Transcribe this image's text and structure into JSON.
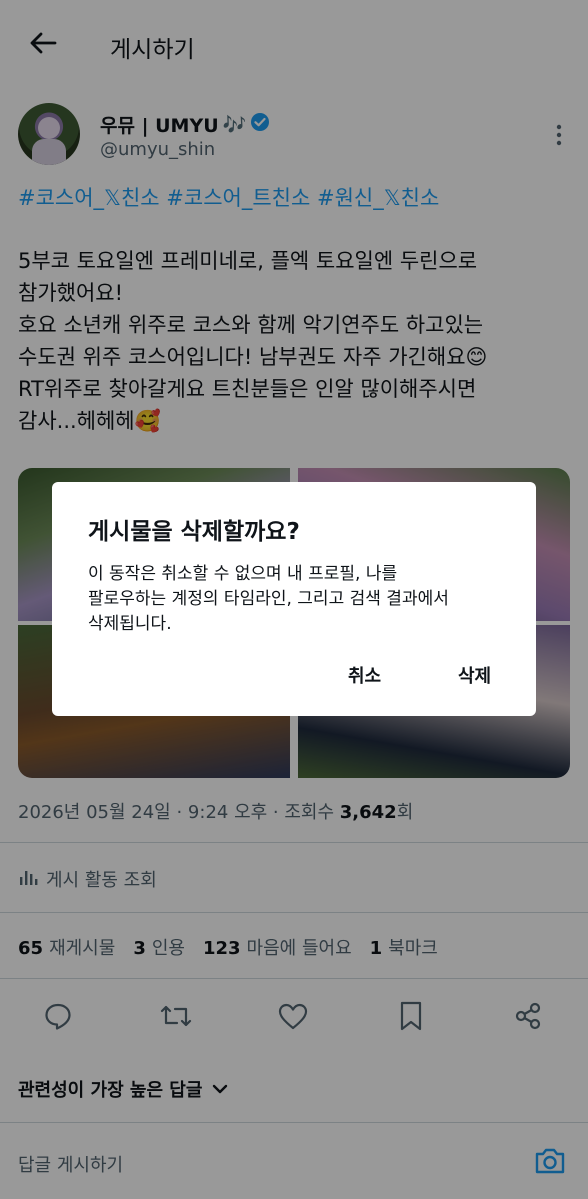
{
  "header": {
    "title": "게시하기",
    "back_icon": "arrow-left-icon"
  },
  "author": {
    "name": "우뮤 | UMYU",
    "name_emoji": "🎶",
    "handle": "@umyu_shin",
    "verified": true,
    "verified_color": "#1d9bf0"
  },
  "post": {
    "hashtags": "#코스어_𝕏친소 #코스어_트친소 #원신_𝕏친소",
    "lines": [
      "5부코 토요일엔 프레미네로, 플엑 토요일엔 두린으로",
      "참가했어요!",
      "호요 소년캐 위주로 코스와 함께 악기연주도 하고있는",
      "수도권 위주 코스어입니다! 남부권도 자주 가긴해요😊",
      "RT위주로 찾아갈게요 트친분들은 인알 많이해주시면",
      "감사...헤헤헤🥰"
    ]
  },
  "timestamp": {
    "date": "2026년 05월 24일",
    "sep1": " · ",
    "time": "9:24 오후",
    "sep2": " · ",
    "views_label": "조회수 ",
    "views": "3,642",
    "views_suffix": "회"
  },
  "activity": {
    "label": "게시 활동 조회"
  },
  "stats": [
    {
      "count": "65",
      "label": "재게시물"
    },
    {
      "count": "3",
      "label": "인용"
    },
    {
      "count": "123",
      "label": "마음에 들어요"
    },
    {
      "count": "1",
      "label": "북마크"
    }
  ],
  "actions": [
    "reply-icon",
    "repost-icon",
    "like-icon",
    "bookmark-icon",
    "share-icon"
  ],
  "replies": {
    "sort_label": "관련성이 가장 높은 답글",
    "placeholder": "답글 게시하기"
  },
  "dialog": {
    "title": "게시물을 삭제할까요?",
    "message_lines": [
      "이 동작은 취소할 수 없으며 내 프로필, 나를",
      "팔로우하는 계정의 타임라인, 그리고 검색 결과에서",
      "삭제됩니다."
    ],
    "cancel_label": "취소",
    "delete_label": "삭제"
  },
  "colors": {
    "accent": "#1d9bf0",
    "text": "#0f1419",
    "muted": "#536471",
    "overlay": "rgba(0,0,0,0.40)"
  }
}
